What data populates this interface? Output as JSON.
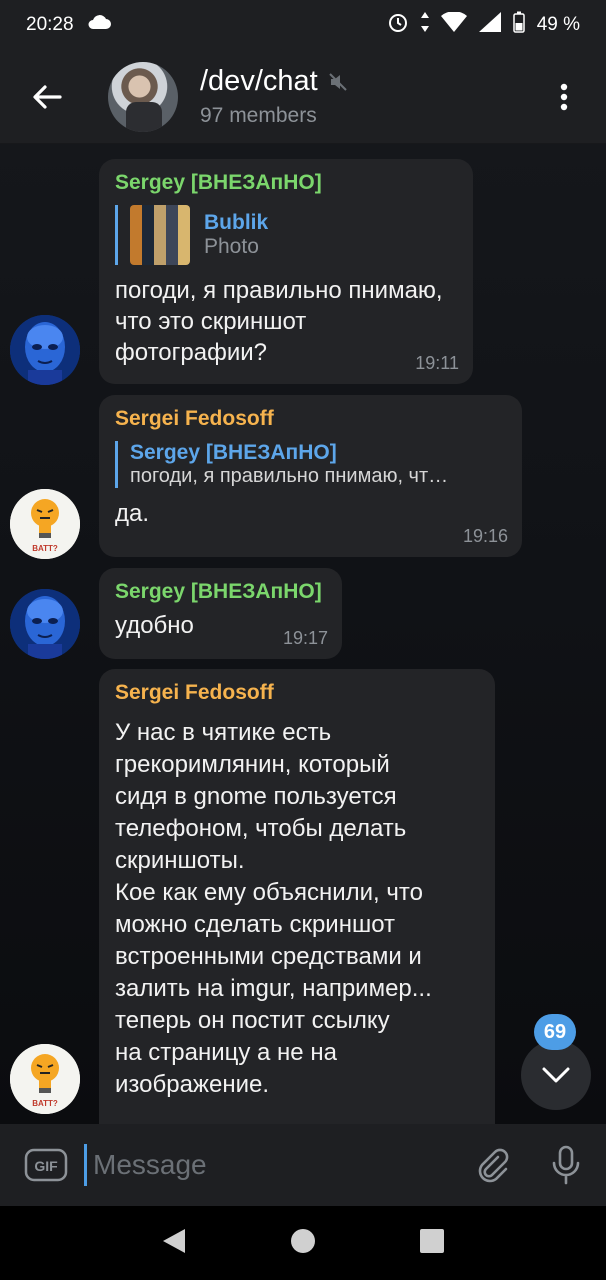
{
  "status": {
    "time": "20:28",
    "battery": "49 %"
  },
  "header": {
    "title": "/dev/chat",
    "members": "97 members"
  },
  "messages": [
    {
      "sender": "Sergey [ВНЕЗАпНО]",
      "reply_name": "Bublik",
      "reply_sub": "Photo",
      "text": "погоди, я правильно пнимаю, что это скриншот фотографии?",
      "time": "19:11"
    },
    {
      "sender": "Sergei Fedosoff",
      "reply_name": "Sergey [ВНЕЗАпНО]",
      "reply_text": "погоди, я правильно пнимаю, чт…",
      "text": "да.",
      "time": "19:16"
    },
    {
      "sender": "Sergey [ВНЕЗАпНО]",
      "text": "удобно",
      "time": "19:17"
    },
    {
      "sender": "Sergei Fedosoff",
      "lines": [
        "У нас в чятике есть",
        "грекоримлянин, который",
        "сидя в gnome пользуется",
        "телефоном, чтобы делать",
        "скриншоты.",
        "Кое как ему объяснили, что",
        "можно сделать скриншот",
        "встроенными средствами и",
        "залить на imgur, например...",
        "теперь он постит ссылку",
        "на страницу а не на",
        "изображение."
      ]
    }
  ],
  "avatar_badge": "BATT?",
  "unread_count": "69",
  "input": {
    "placeholder": "Message"
  },
  "gif_label": "GIF",
  "colors": {
    "accent": "#4d9de6",
    "green_sender": "#7bd66c",
    "orange_sender": "#f6b34e",
    "bubble": "#232427"
  }
}
